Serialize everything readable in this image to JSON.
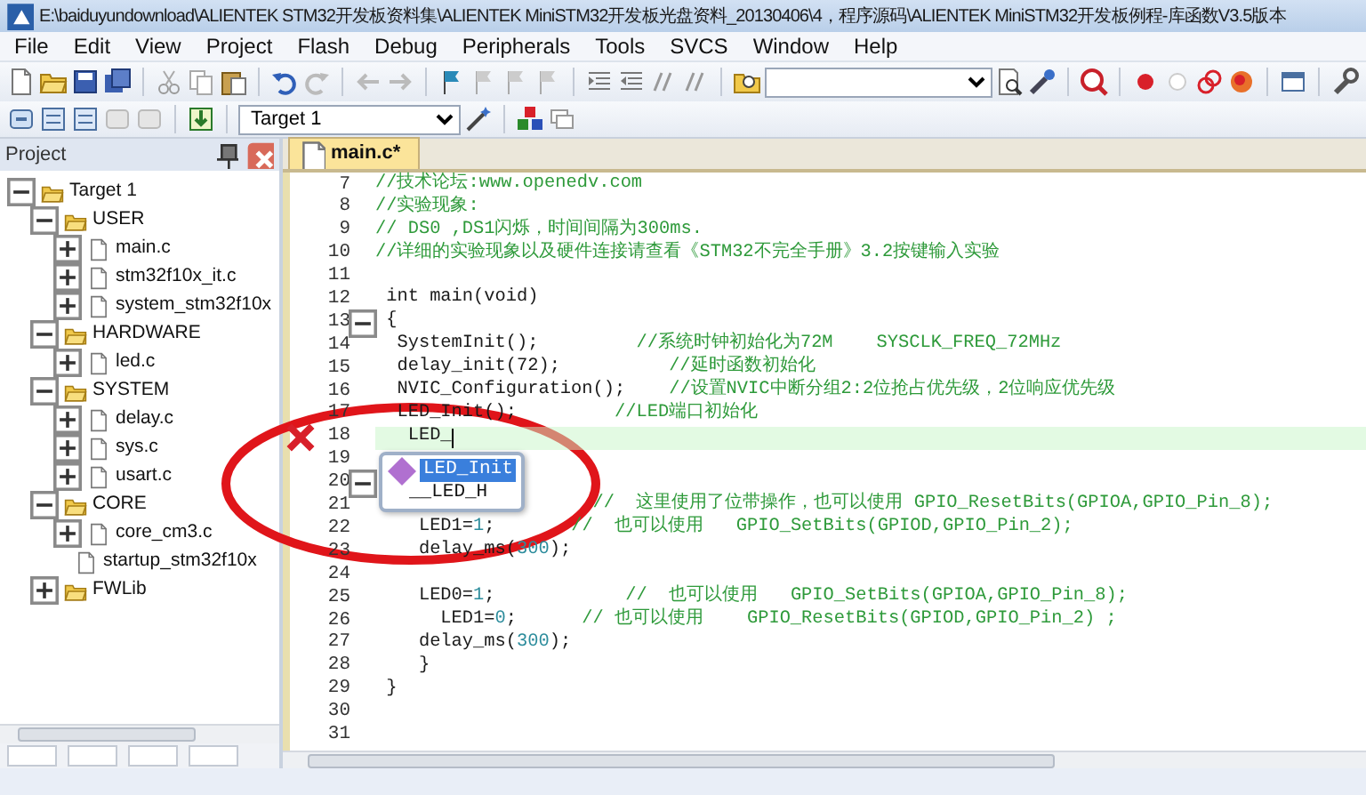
{
  "window": {
    "title": "E:\\baiduyundownload\\ALIENTEK STM32开发板资料集\\ALIENTEK MiniSTM32开发板光盘资料_20130406\\4，程序源码\\ALIENTEK MiniSTM32开发板例程-库函数V3.5版本"
  },
  "menu": [
    "File",
    "Edit",
    "View",
    "Project",
    "Flash",
    "Debug",
    "Peripherals",
    "Tools",
    "SVCS",
    "Window",
    "Help"
  ],
  "build_toolbar": {
    "target": "Target 1"
  },
  "project_panel": {
    "title": "Project",
    "tree": [
      {
        "label": "Target 1",
        "kind": "target",
        "expanded": true,
        "children": [
          {
            "label": "USER",
            "kind": "group",
            "expanded": true,
            "children": [
              {
                "label": "main.c",
                "kind": "file",
                "expanded": false
              },
              {
                "label": "stm32f10x_it.c",
                "kind": "file",
                "expanded": false
              },
              {
                "label": "system_stm32f10x",
                "kind": "file",
                "expanded": false
              }
            ]
          },
          {
            "label": "HARDWARE",
            "kind": "group",
            "expanded": true,
            "children": [
              {
                "label": "led.c",
                "kind": "file",
                "expanded": false
              }
            ]
          },
          {
            "label": "SYSTEM",
            "kind": "group",
            "expanded": true,
            "children": [
              {
                "label": "delay.c",
                "kind": "file",
                "expanded": false
              },
              {
                "label": "sys.c",
                "kind": "file",
                "expanded": false
              },
              {
                "label": "usart.c",
                "kind": "file",
                "expanded": false
              }
            ]
          },
          {
            "label": "CORE",
            "kind": "group",
            "expanded": true,
            "children": [
              {
                "label": "core_cm3.c",
                "kind": "file",
                "expanded": false
              },
              {
                "label": "startup_stm32f10x",
                "kind": "leaf",
                "expanded": false
              }
            ]
          },
          {
            "label": "FWLib",
            "kind": "group",
            "expanded": false
          }
        ]
      }
    ]
  },
  "editor": {
    "tabs": [
      {
        "label": "main.c*",
        "selected": true
      }
    ],
    "lines": [
      {
        "number": "7",
        "fold": false,
        "current": false,
        "error": false,
        "segments": [
          {
            "kind": "comment",
            "text": "//技术论坛:www.openedv.com"
          }
        ]
      },
      {
        "number": "8",
        "fold": false,
        "current": false,
        "error": false,
        "segments": [
          {
            "kind": "comment",
            "text": "//实验现象:"
          }
        ]
      },
      {
        "number": "9",
        "fold": false,
        "current": false,
        "error": false,
        "segments": [
          {
            "kind": "comment",
            "text": "// DS0 ,DS1闪烁，时间间隔为300ms."
          }
        ]
      },
      {
        "number": "10",
        "fold": false,
        "current": false,
        "error": false,
        "segments": [
          {
            "kind": "comment",
            "text": "//详细的实验现象以及硬件连接请查看《STM32不完全手册》3.2按键输入实验"
          }
        ]
      },
      {
        "number": "11",
        "fold": false,
        "current": false,
        "error": false
      },
      {
        "number": "12",
        "fold": false,
        "current": false,
        "error": false,
        "segments": [
          {
            "kind": "code",
            "text": " int main(void)"
          }
        ]
      },
      {
        "number": "13",
        "fold": true,
        "current": false,
        "error": false,
        "segments": [
          {
            "kind": "code",
            "text": " {"
          }
        ]
      },
      {
        "number": "14",
        "fold": false,
        "current": false,
        "error": false,
        "segments": [
          {
            "kind": "code",
            "text": "  SystemInit();"
          },
          {
            "kind": "comment",
            "text": "         //系统时钟初始化为72M    SYSCLK_FREQ_72MHz"
          }
        ]
      },
      {
        "number": "15",
        "fold": false,
        "current": false,
        "error": false,
        "segments": [
          {
            "kind": "code",
            "text": "  delay_init(72);"
          },
          {
            "kind": "comment",
            "text": "          //延时函数初始化"
          }
        ]
      },
      {
        "number": "16",
        "fold": false,
        "current": false,
        "error": false,
        "segments": [
          {
            "kind": "code",
            "text": "  NVIC_Configuration();"
          },
          {
            "kind": "comment",
            "text": "    //设置NVIC中断分组2:2位抢占优先级，2位响应优先级"
          }
        ]
      },
      {
        "number": "17",
        "fold": false,
        "current": false,
        "error": false,
        "segments": [
          {
            "kind": "code",
            "text": "  LED_Init();"
          },
          {
            "kind": "comment",
            "text": "         //LED端口初始化"
          }
        ]
      },
      {
        "number": "18",
        "fold": false,
        "current": true,
        "error": true,
        "segments": [
          {
            "kind": "code",
            "text": "   LED_"
          }
        ]
      },
      {
        "number": "19",
        "fold": false,
        "current": false,
        "error": false
      },
      {
        "number": "20",
        "fold": true,
        "current": false,
        "error": false
      },
      {
        "number": "21",
        "fold": false,
        "current": false,
        "error": false,
        "segments": [
          {
            "kind": "comment",
            "text": "                    //  这里使用了位带操作，也可以使用 GPIO_ResetBits(GPIOA,GPIO_Pin_8);"
          }
        ]
      },
      {
        "number": "22",
        "fold": false,
        "current": false,
        "error": false,
        "segments": [
          {
            "kind": "code",
            "text": "    LED1="
          },
          {
            "kind": "number",
            "text": "1"
          },
          {
            "kind": "code",
            "text": ";"
          },
          {
            "kind": "comment",
            "text": "       //  也可以使用   GPIO_SetBits(GPIOD,GPIO_Pin_2);"
          }
        ]
      },
      {
        "number": "23",
        "fold": false,
        "current": false,
        "error": false,
        "segments": [
          {
            "kind": "code",
            "text": "    delay_ms("
          },
          {
            "kind": "number",
            "text": "300"
          },
          {
            "kind": "code",
            "text": ");"
          }
        ]
      },
      {
        "number": "24",
        "fold": false,
        "current": false,
        "error": false
      },
      {
        "number": "25",
        "fold": false,
        "current": false,
        "error": false,
        "segments": [
          {
            "kind": "code",
            "text": "    LED0="
          },
          {
            "kind": "number",
            "text": "1"
          },
          {
            "kind": "code",
            "text": ";"
          },
          {
            "kind": "comment",
            "text": "            //  也可以使用   GPIO_SetBits(GPIOA,GPIO_Pin_8);"
          }
        ]
      },
      {
        "number": "26",
        "fold": false,
        "current": false,
        "error": false,
        "segments": [
          {
            "kind": "code",
            "text": "      LED1="
          },
          {
            "kind": "number",
            "text": "0"
          },
          {
            "kind": "code",
            "text": ";"
          },
          {
            "kind": "comment",
            "text": "      // 也可以使用    GPIO_ResetBits(GPIOD,GPIO_Pin_2) ;"
          }
        ]
      },
      {
        "number": "27",
        "fold": false,
        "current": false,
        "error": false,
        "segments": [
          {
            "kind": "code",
            "text": "    delay_ms("
          },
          {
            "kind": "number",
            "text": "300"
          },
          {
            "kind": "code",
            "text": ");"
          }
        ]
      },
      {
        "number": "28",
        "fold": false,
        "current": false,
        "error": false,
        "segments": [
          {
            "kind": "code",
            "text": "    }"
          }
        ]
      },
      {
        "number": "29",
        "fold": false,
        "current": false,
        "error": false,
        "segments": [
          {
            "kind": "code",
            "text": " }"
          }
        ]
      },
      {
        "number": "30",
        "fold": false,
        "current": false,
        "error": false
      },
      {
        "number": "31",
        "fold": false,
        "current": false,
        "error": false
      }
    ],
    "autocomplete": [
      {
        "label": "LED_Init",
        "selected": true
      },
      {
        "label": "__LED_H",
        "selected": false
      }
    ]
  }
}
